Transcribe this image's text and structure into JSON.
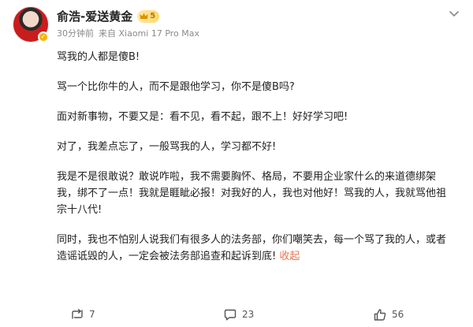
{
  "post": {
    "author": "俞浩-爱送黄金",
    "vip_label": "5",
    "time": "30分钟前",
    "source": "来自 Xiaomi 17 Pro Max",
    "paragraphs": [
      "骂我的人都是傻B!",
      "骂一个比你牛的人，而不是跟他学习，你不是傻B吗?",
      "面对新事物，不要又是：看不见，看不起，跟不上！好好学习吧!",
      "对了，我差点忘了，一般骂我的人，学习都不好!",
      "我是不是很敢说？敢说咋啦，我不需要胸怀、格局，不要用企业家什么的来道德绑架我，绑不了一点！我就是睚眦必报！对我好的人，我也对他好！骂我的人，我就骂他祖宗十八代!",
      "同时，我也不怕别人说我们有很多人的法务部，你们嘲笑去，每一个骂了我的人，或者造谣诋毁的人，一定会被法务部追查和起诉到底!"
    ],
    "collapse_label": "收起"
  },
  "actions": {
    "repost_count": "7",
    "comment_count": "23",
    "like_count": "56"
  },
  "icons": {
    "verified": "verified-badge-icon",
    "vip": "vip-crown-icon",
    "menu": "chevron-down-icon",
    "repost": "repost-icon",
    "comment": "comment-icon",
    "like": "like-icon"
  },
  "colors": {
    "link": "#eb7350",
    "meta": "#8a8a8a",
    "verified": "#f7b400"
  }
}
